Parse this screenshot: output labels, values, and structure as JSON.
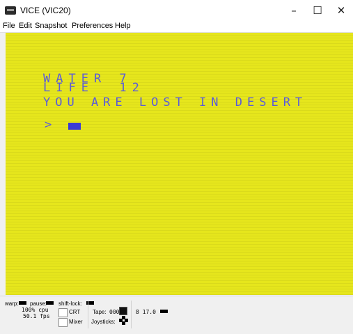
{
  "window": {
    "title": "VICE (VIC20)",
    "minimize": "–",
    "maximize": "☐",
    "close": "✕"
  },
  "menu": [
    "File",
    "Edit",
    "Snapshot",
    "Preferences",
    "Help"
  ],
  "screen": {
    "lines": [
      "WATER 7",
      "LIFE  12",
      "YOU ARE LOST IN DESERT"
    ],
    "prompt": ">",
    "background": "#e6e61c",
    "text_color": "#5a5cd8"
  },
  "status": {
    "warp_label": "warp:",
    "pause_label": "pause:",
    "shiftlock_label": "shift-lock:",
    "cpu": "100% cpu",
    "fps": "50.1 fps",
    "crt_label": "CRT",
    "mixer_label": "Mixer",
    "tape_label": "Tape:",
    "tape_counter": "000",
    "joysticks_label": "Joysticks:",
    "drive": "8 17.0"
  }
}
